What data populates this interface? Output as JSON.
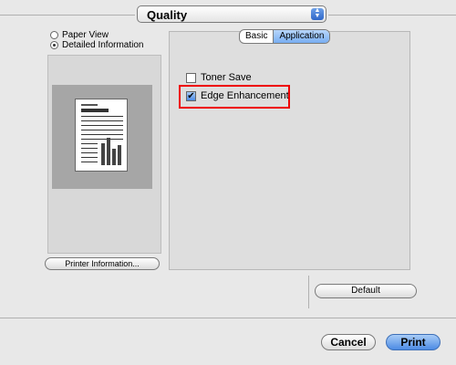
{
  "popup": {
    "label": "Quality"
  },
  "left": {
    "view_options": [
      {
        "label": "Paper View",
        "selected": false
      },
      {
        "label": "Detailed Information",
        "selected": true
      }
    ],
    "printer_info_label": "Printer Information..."
  },
  "tabs": [
    {
      "label": "Basic",
      "selected": false
    },
    {
      "label": "Application",
      "selected": true
    }
  ],
  "options": {
    "toner_save": {
      "label": "Toner Save",
      "checked": false
    },
    "edge_enhancement": {
      "label": "Edge Enhancement",
      "checked": true
    }
  },
  "buttons": {
    "default": "Default",
    "cancel": "Cancel",
    "print": "Print"
  },
  "colors": {
    "highlight": "#e00000",
    "print_button": "#4c8be4",
    "selected_tab": "#78aef2"
  },
  "icons": {
    "popup": "updown-arrows-icon",
    "checkbox_checked": "checkmark-icon"
  }
}
